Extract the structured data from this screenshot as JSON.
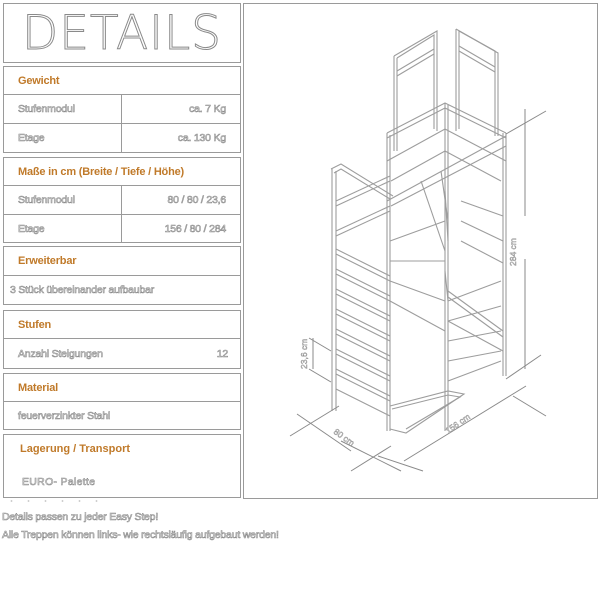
{
  "title": "DETAILS",
  "sections": {
    "weight": {
      "header": "Gewicht",
      "rows": [
        {
          "label": "Stufenmodul",
          "value": "ca. 7 Kg"
        },
        {
          "label": "Etage",
          "value": "ca. 130 Kg"
        }
      ]
    },
    "dimensions": {
      "header": "Maße in cm (Breite / Tiefe / Höhe)",
      "rows": [
        {
          "label": "Stufenmodul",
          "value": "80 / 80 / 23,6"
        },
        {
          "label": "Etage",
          "value": "156 / 80 / 284"
        }
      ]
    },
    "extendable": {
      "header": "Erweiterbar",
      "text": "3 Stück übereinander aufbaubar"
    },
    "steps": {
      "header": "Stufen",
      "label": "Anzahl Steigungen",
      "value": "12"
    },
    "material": {
      "header": "Material",
      "text": "feuerverzinkter Stahl"
    },
    "storage": {
      "header": "Lagerung /  Transport",
      "text": "EURO-  Palette"
    }
  },
  "drawing": {
    "height_label": "284 cm",
    "step_height_label": "23,6 cm",
    "depth_label": "80 cm",
    "width_label": "156 cm"
  },
  "footer": {
    "line1": "Details passen zu jeder Easy Step!",
    "line2": "Alle Treppen können links- wie rechtsläufig aufgebaut werden!"
  },
  "colors": {
    "accent": "#c07a2a",
    "border": "#9a9a9a",
    "text_outline": "#8c8c8c"
  }
}
